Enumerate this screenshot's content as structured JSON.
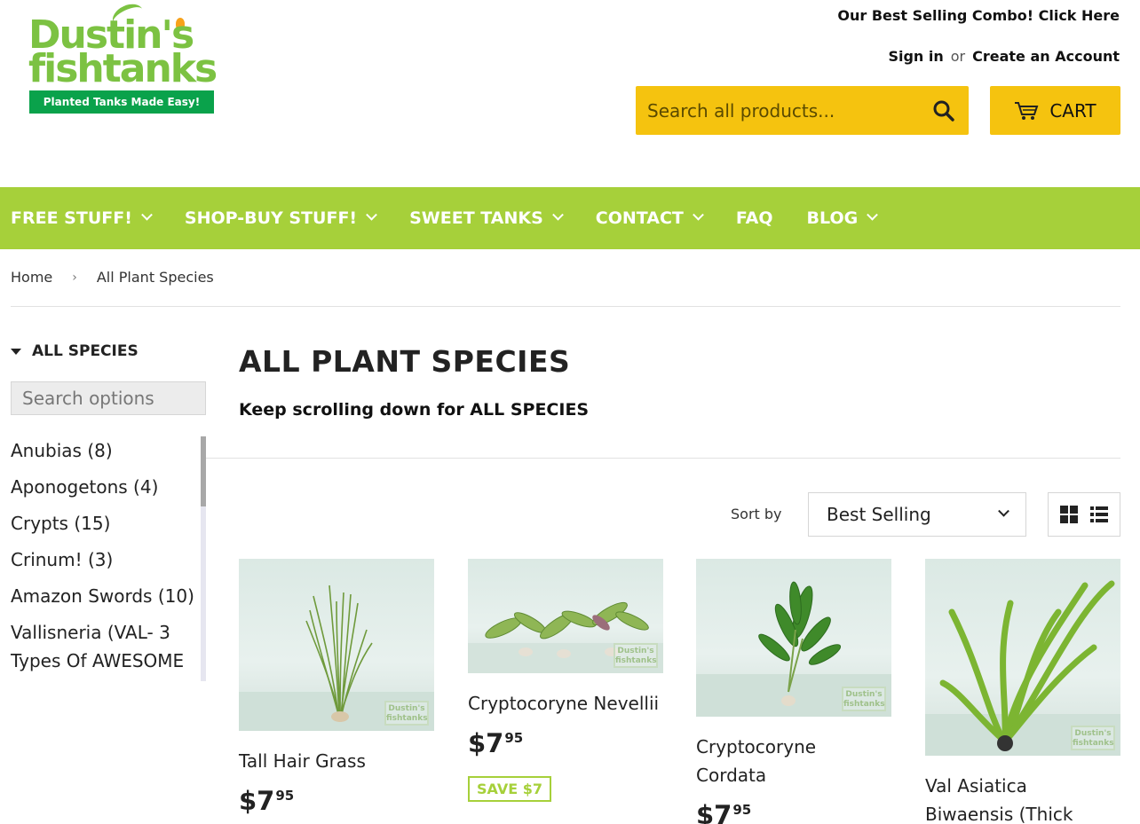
{
  "header": {
    "logo_line1": "Dustin's",
    "logo_line2": "fishtanks",
    "logo_tagline": "Planted Tanks Made Easy!",
    "promo_link": "Our Best Selling Combo! Click Here",
    "sign_in": "Sign in",
    "or": "or",
    "create_account": "Create an Account",
    "search_placeholder": "Search all products...",
    "cart_label": "CART",
    "accent_color": "#f5c30f"
  },
  "nav": {
    "color": "#a6d03a",
    "items": [
      {
        "label": "FREE STUFF!"
      },
      {
        "label": "SHOP-BUY STUFF!"
      },
      {
        "label": "SWEET TANKS"
      },
      {
        "label": "CONTACT"
      },
      {
        "label": "FAQ"
      },
      {
        "label": "BLOG"
      }
    ]
  },
  "breadcrumb": {
    "home": "Home",
    "separator": "›",
    "current": "All Plant Species"
  },
  "sidebar": {
    "heading": "ALL SPECIES",
    "search_placeholder": "Search options",
    "options": [
      "Anubias (8)",
      "Aponogetons (4)",
      "Crypts (15)",
      "Crinum! (3)",
      "Amazon Swords (10)",
      "Vallisneria (VAL- 3 Types Of AWESOME"
    ]
  },
  "main": {
    "title": "ALL PLANT SPECIES",
    "description": "Keep scrolling down for ALL SPECIES",
    "sort_label": "Sort by",
    "sort_value": "Best Selling"
  },
  "products": [
    {
      "title": "Tall Hair Grass",
      "price_dollars": "$7",
      "price_cents": "95",
      "save": ""
    },
    {
      "title": "Cryptocoryne Nevellii",
      "price_dollars": "$7",
      "price_cents": "95",
      "save": "SAVE $7"
    },
    {
      "title": "Cryptocoryne Cordata",
      "price_dollars": "$7",
      "price_cents": "95",
      "save": ""
    },
    {
      "title": "Val Asiatica Biwaensis (Thick Corkscrew val)",
      "price_dollars": "",
      "price_cents": "",
      "save": ""
    }
  ],
  "watermark_line1": "Dustin's",
  "watermark_line2": "fishtanks"
}
